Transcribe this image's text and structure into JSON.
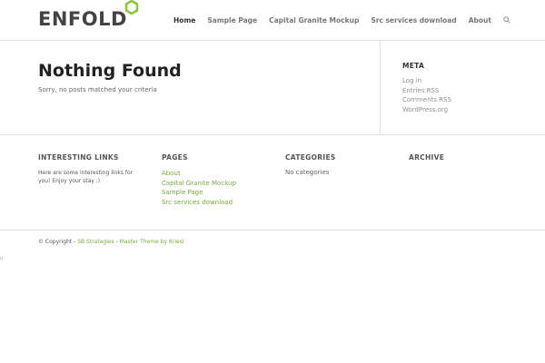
{
  "header": {
    "logo_text": "ENFOLD",
    "nav": [
      "Home",
      "Sample Page",
      "Capital Granite Mockup",
      "Src services download",
      "About"
    ]
  },
  "main": {
    "title": "Nothing Found",
    "message": "Sorry, no posts matched your criteria"
  },
  "sidebar": {
    "title": "META",
    "links": [
      "Log in",
      "Entries RSS",
      "Comments RSS",
      "WordPress.org"
    ]
  },
  "footer": {
    "interesting": {
      "title": "INTERESTING LINKS",
      "text": "Here are some interesting links for you! Enjoy your stay :)"
    },
    "pages": {
      "title": "PAGES",
      "links": [
        "About",
        "Capital Granite Mockup",
        "Sample Page",
        "Src services download"
      ]
    },
    "categories": {
      "title": "CATEGORIES",
      "text": "No categories"
    },
    "archive": {
      "title": "ARCHIVE"
    }
  },
  "socket": {
    "prefix": "© Copyright - ",
    "site_link": "SB Strategies",
    "separator": " - ",
    "theme_link": "Master Theme by Kriesi"
  },
  "stray_char": "u",
  "colors": {
    "accent": "#7aa93c",
    "heading": "#222222",
    "text": "#666666",
    "border": "#e1e1e1"
  }
}
